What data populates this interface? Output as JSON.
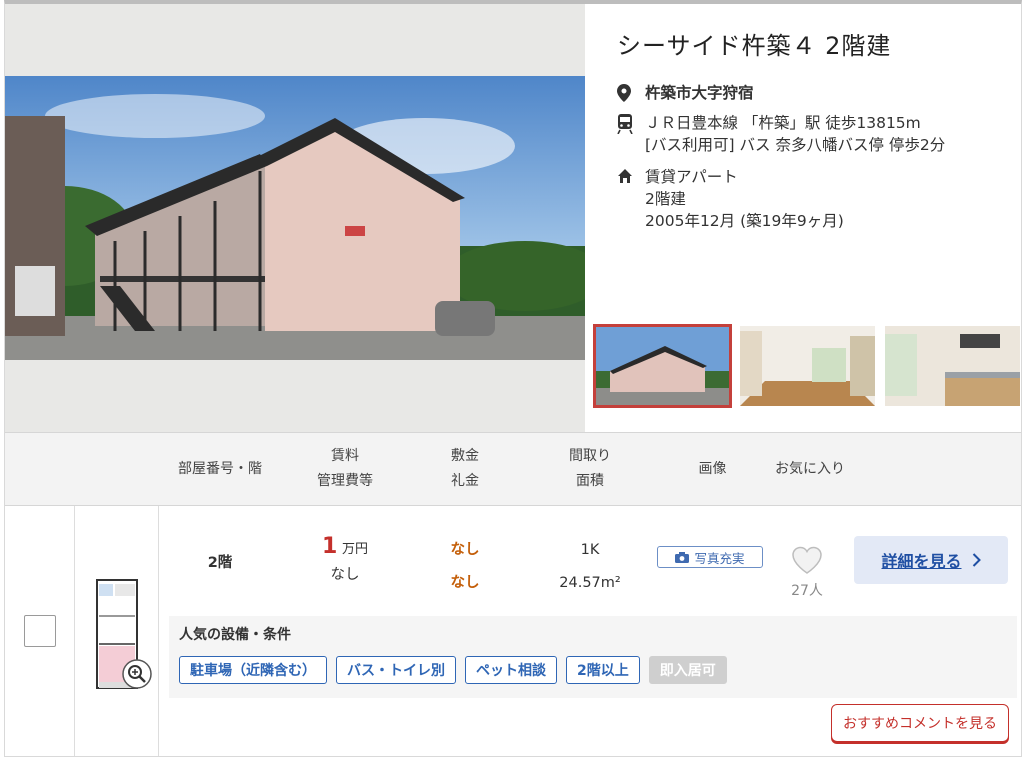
{
  "property": {
    "title": "シーサイド杵築４ 2階建",
    "address": "杵築市大字狩宿",
    "access_line1": "ＪＲ日豊本線 「杵築」駅 徒歩13815m",
    "access_line2": "[バス利用可] バス 奈多八幡バス停 停歩2分",
    "type": "賃貸アパート",
    "floors": "2階建",
    "built": "2005年12月 (築19年9ヶ月)"
  },
  "icons": {
    "address": "location-pin-icon",
    "access": "train-icon",
    "building": "home-icon",
    "photo": "camera-icon",
    "favorite": "heart-icon",
    "zoom": "zoom-in-icon",
    "arrow": "chevron-right-icon"
  },
  "table_header": {
    "room": "部屋番号・階",
    "rent": "賃料",
    "mgmt": "管理費等",
    "deposit": "敷金",
    "key_money": "礼金",
    "layout": "間取り",
    "area": "面積",
    "image": "画像",
    "favorite": "お気に入り"
  },
  "listing": {
    "floor": "2階",
    "rent_value": "1",
    "rent_unit": "万円",
    "mgmt_fee": "なし",
    "deposit": "なし",
    "key_money": "なし",
    "layout": "1K",
    "area": "24.57m²",
    "photo_badge": "写真充実",
    "fav_count": "27人",
    "detail_button": "詳細を見る",
    "features_title": "人気の設備・条件",
    "tags": [
      {
        "label": "駐車場（近隣含む）",
        "active": true
      },
      {
        "label": "バス・トイレ別",
        "active": true
      },
      {
        "label": "ペット相談",
        "active": true
      },
      {
        "label": "2階以上",
        "active": true
      },
      {
        "label": "即入居可",
        "active": false
      }
    ],
    "comment_button": "おすすめコメントを見る"
  },
  "colors": {
    "accent_red": "#c4302b",
    "link_blue": "#1f4fa3",
    "tag_blue": "#2f66b5",
    "deposit_orange": "#c45f0a"
  }
}
